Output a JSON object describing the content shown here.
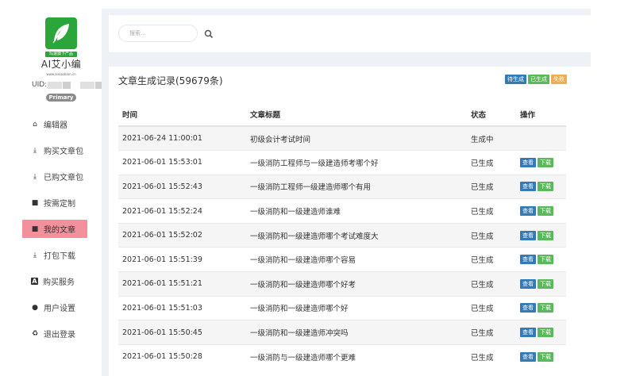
{
  "sidebar": {
    "logo_tag": "玛速旗下产品",
    "brand": "AI艾小编",
    "brand_url": "www.aixiaobian.cn",
    "uid_label": "UID:",
    "role_badge": "Primary",
    "items": [
      {
        "label": "编辑器",
        "icon": "home-icon"
      },
      {
        "label": "购买文章包",
        "icon": "download-icon"
      },
      {
        "label": "已购文章包",
        "icon": "download-icon"
      },
      {
        "label": "按需定制",
        "icon": "file-icon"
      },
      {
        "label": "我的文章",
        "icon": "file-icon",
        "active": true
      },
      {
        "label": "打包下载",
        "icon": "download-icon"
      },
      {
        "label": "购买服务",
        "icon": "a-box-icon"
      },
      {
        "label": "用户设置",
        "icon": "user-icon"
      },
      {
        "label": "退出登录",
        "icon": "recycle-icon"
      }
    ]
  },
  "search": {
    "placeholder": "搜索..."
  },
  "records": {
    "title": "文章生成记录(59679条)",
    "legend": {
      "pending": "待生成",
      "done": "已生成",
      "failed": "失败"
    },
    "columns": {
      "time": "时间",
      "title": "文章标题",
      "status": "状态",
      "action": "操作"
    },
    "view_label": "查看",
    "download_label": "下载",
    "rows": [
      {
        "time": "2021-06-24 11:00:01",
        "title": "初级会计考试时间",
        "status": "生成中"
      },
      {
        "time": "2021-06-01 15:53:01",
        "title": "一级消防工程师与一级建造师考哪个好",
        "status": "已生成"
      },
      {
        "time": "2021-06-01 15:52:43",
        "title": "一级消防工程师一级建造师哪个有用",
        "status": "已生成"
      },
      {
        "time": "2021-06-01 15:52:24",
        "title": "一级消防和一级建造师谁难",
        "status": "已生成"
      },
      {
        "time": "2021-06-01 15:52:02",
        "title": "一级消防和一级建造师哪个考试难度大",
        "status": "已生成"
      },
      {
        "time": "2021-06-01 15:51:39",
        "title": "一级消防和一级建造师哪个容易",
        "status": "已生成"
      },
      {
        "time": "2021-06-01 15:51:21",
        "title": "一级消防和一级建造师哪个好考",
        "status": "已生成"
      },
      {
        "time": "2021-06-01 15:51:03",
        "title": "一级消防和一级建造师哪个好",
        "status": "已生成"
      },
      {
        "time": "2021-06-01 15:50:45",
        "title": "一级消防和一级建造师冲突吗",
        "status": "已生成"
      },
      {
        "time": "2021-06-01 15:50:28",
        "title": "一级消防与一级建造师哪个更难",
        "status": "已生成"
      }
    ]
  }
}
